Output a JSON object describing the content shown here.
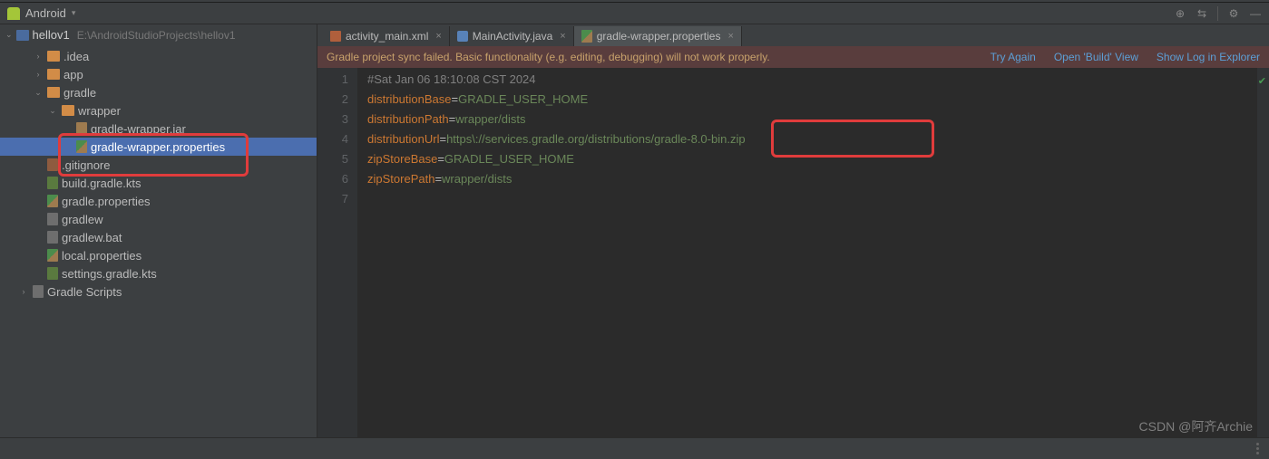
{
  "toolbar": {
    "view_label": "Android"
  },
  "project": {
    "name": "hellov1",
    "path": "E:\\AndroidStudioProjects\\hellov1",
    "tree": [
      {
        "label": ".idea",
        "indent": 2,
        "arrow": "›",
        "icon": "folder"
      },
      {
        "label": "app",
        "indent": 2,
        "arrow": "›",
        "icon": "folder"
      },
      {
        "label": "gradle",
        "indent": 2,
        "arrow": "⌄",
        "icon": "folder"
      },
      {
        "label": "wrapper",
        "indent": 3,
        "arrow": "⌄",
        "icon": "folder"
      },
      {
        "label": "gradle-wrapper.jar",
        "indent": 4,
        "arrow": "",
        "icon": "jar"
      },
      {
        "label": "gradle-wrapper.properties",
        "indent": 4,
        "arrow": "",
        "icon": "props",
        "selected": true
      },
      {
        "label": ".gitignore",
        "indent": 2,
        "arrow": "",
        "icon": "git"
      },
      {
        "label": "build.gradle.kts",
        "indent": 2,
        "arrow": "",
        "icon": "kts"
      },
      {
        "label": "gradle.properties",
        "indent": 2,
        "arrow": "",
        "icon": "props"
      },
      {
        "label": "gradlew",
        "indent": 2,
        "arrow": "",
        "icon": "file"
      },
      {
        "label": "gradlew.bat",
        "indent": 2,
        "arrow": "",
        "icon": "file"
      },
      {
        "label": "local.properties",
        "indent": 2,
        "arrow": "",
        "icon": "props"
      },
      {
        "label": "settings.gradle.kts",
        "indent": 2,
        "arrow": "",
        "icon": "kts"
      },
      {
        "label": "Gradle Scripts",
        "indent": 1,
        "arrow": "›",
        "icon": "file"
      }
    ]
  },
  "tabs": [
    {
      "label": "activity_main.xml",
      "icon": "xml"
    },
    {
      "label": "MainActivity.java",
      "icon": "java"
    },
    {
      "label": "gradle-wrapper.properties",
      "icon": "props",
      "active": true
    }
  ],
  "sync_bar": {
    "message": "Gradle project sync failed. Basic functionality (e.g. editing, debugging) will not work properly.",
    "link_try": "Try Again",
    "link_open": "Open 'Build' View",
    "link_log": "Show Log in Explorer"
  },
  "code": {
    "line1_comment": "#Sat Jan 06 18:10:08 CST 2024",
    "line2_key": "distributionBase",
    "line2_val": "GRADLE_USER_HOME",
    "line3_key": "distributionPath",
    "line3_val": "wrapper/dists",
    "line4_key": "distributionUrl",
    "line4_val": "https\\://services.gradle.org/distributions/gradle-8.0-bin.zip",
    "line5_key": "zipStoreBase",
    "line5_val": "GRADLE_USER_HOME",
    "line6_key": "zipStorePath",
    "line6_val": "wrapper/dists",
    "lines": [
      "1",
      "2",
      "3",
      "4",
      "5",
      "6",
      "7"
    ]
  },
  "watermark": "CSDN @阿齐Archie"
}
